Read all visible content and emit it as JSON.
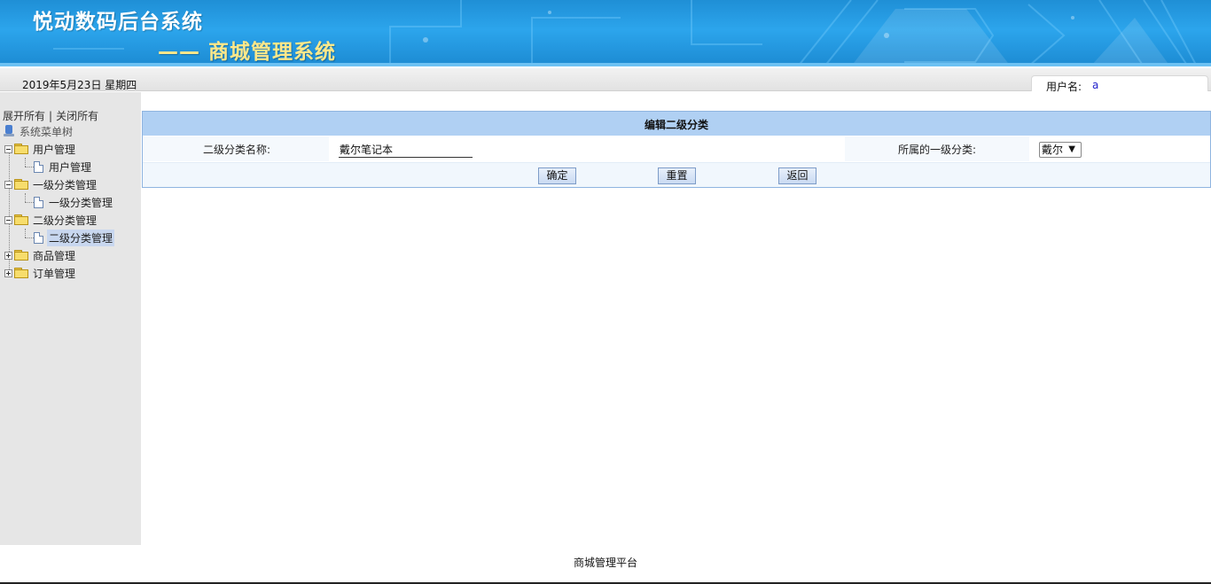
{
  "header": {
    "title": "悦动数码后台系统",
    "subtitle": "—— 商城管理系统"
  },
  "infobar": {
    "date": "2019年5月23日 星期四",
    "user_label": "用户名:",
    "user_value": "a"
  },
  "sidebar": {
    "expand_all": "展开所有",
    "separator": "|",
    "collapse_all": "关闭所有",
    "root": "系统菜单树",
    "groups": [
      {
        "label": "用户管理",
        "expanded": true,
        "children": [
          "用户管理"
        ]
      },
      {
        "label": "一级分类管理",
        "expanded": true,
        "children": [
          "一级分类管理"
        ]
      },
      {
        "label": "二级分类管理",
        "expanded": true,
        "children": [
          "二级分类管理"
        ],
        "selected_child": 0
      },
      {
        "label": "商品管理",
        "expanded": false,
        "children": []
      },
      {
        "label": "订单管理",
        "expanded": false,
        "children": []
      }
    ]
  },
  "form": {
    "heading": "编辑二级分类",
    "name_label": "二级分类名称:",
    "name_value": "戴尔笔记本",
    "parent_label": "所属的一级分类:",
    "parent_selected": "戴尔",
    "buttons": {
      "confirm": "确定",
      "reset": "重置",
      "back": "返回"
    }
  },
  "footer": {
    "text": "商城管理平台"
  },
  "colors": {
    "header_blue": "#2ca5ec",
    "subtitle_yellow": "#ffe88a",
    "form_header": "#b0d0f3",
    "sidebar_bg": "#e6e6e6",
    "selected_bg": "#c8d7ef"
  }
}
